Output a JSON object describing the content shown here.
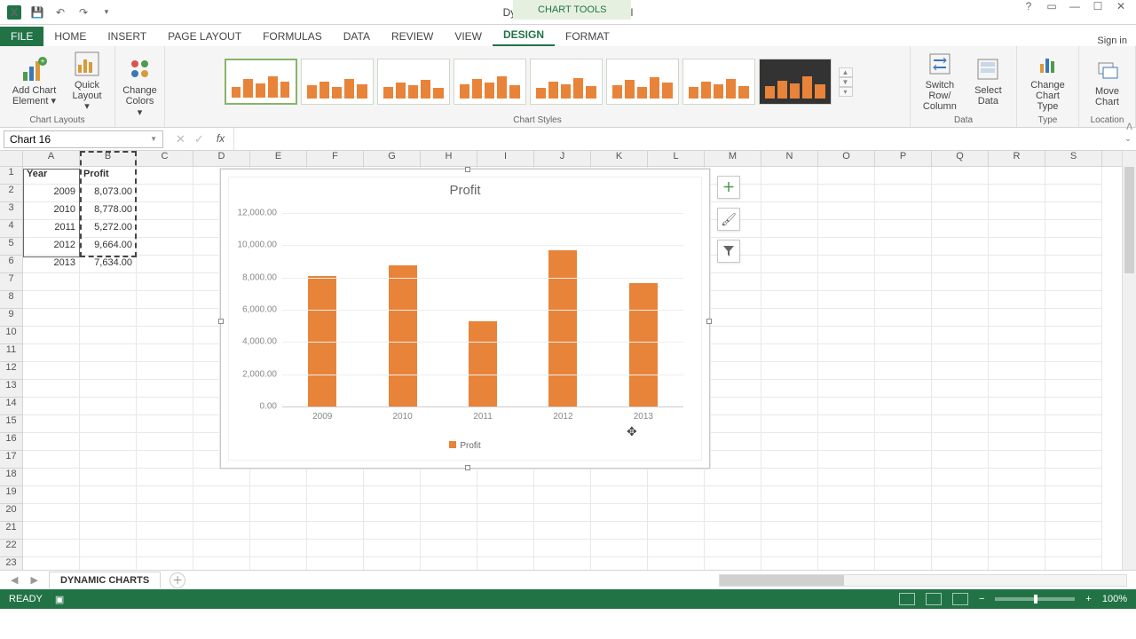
{
  "title": "Dynamic charts.xlsx - Excel",
  "chart_tools_label": "CHART TOOLS",
  "signin": "Sign in",
  "tabs": {
    "file": "FILE",
    "home": "HOME",
    "insert": "INSERT",
    "page_layout": "PAGE LAYOUT",
    "formulas": "FORMULAS",
    "data": "DATA",
    "review": "REVIEW",
    "view": "VIEW",
    "design": "DESIGN",
    "format": "FORMAT"
  },
  "ribbon": {
    "add_chart_element": "Add Chart Element ▾",
    "quick_layout": "Quick Layout ▾",
    "change_colors": "Change Colors ▾",
    "chart_layouts": "Chart Layouts",
    "chart_styles": "Chart Styles",
    "switch_row_col": "Switch Row/\nColumn",
    "select_data": "Select Data",
    "data_group": "Data",
    "change_chart_type": "Change Chart Type",
    "type_group": "Type",
    "move_chart": "Move Chart",
    "location_group": "Location"
  },
  "namebox": "Chart 16",
  "columns": [
    "A",
    "B",
    "C",
    "D",
    "E",
    "F",
    "G",
    "H",
    "I",
    "J",
    "K",
    "L",
    "M",
    "N",
    "O",
    "P",
    "Q",
    "R",
    "S"
  ],
  "row_count": 23,
  "table": {
    "header": {
      "A": "Year",
      "B": "Profit"
    },
    "rows": [
      {
        "A": "2009",
        "B": "8,073.00"
      },
      {
        "A": "2010",
        "B": "8,778.00"
      },
      {
        "A": "2011",
        "B": "5,272.00"
      },
      {
        "A": "2012",
        "B": "9,664.00"
      },
      {
        "A": "2013",
        "B": "7,634.00"
      }
    ]
  },
  "chart_data": {
    "type": "bar",
    "title": "Profit",
    "categories": [
      "2009",
      "2010",
      "2011",
      "2012",
      "2013"
    ],
    "series": [
      {
        "name": "Profit",
        "values": [
          8073,
          8778,
          5272,
          9664,
          7634
        ]
      }
    ],
    "ylim": [
      0,
      12000
    ],
    "yticks": [
      "0.00",
      "2,000.00",
      "4,000.00",
      "6,000.00",
      "8,000.00",
      "10,000.00",
      "12,000.00"
    ]
  },
  "sheet_tab": "DYNAMIC CHARTS",
  "status": {
    "ready": "READY",
    "zoom": "100%"
  }
}
